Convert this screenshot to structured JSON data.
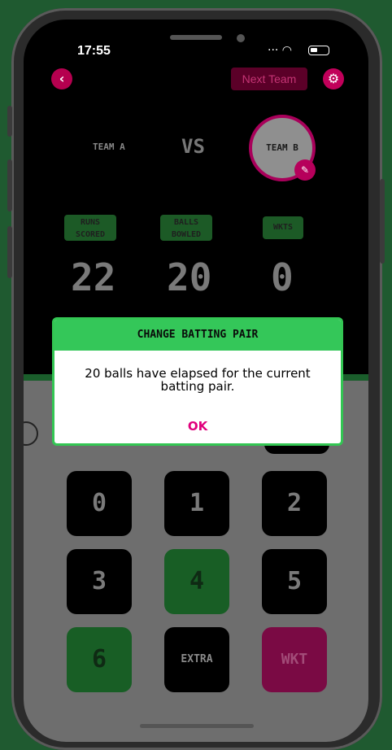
{
  "status_bar": {
    "time": "17:55"
  },
  "header": {
    "next_team_label": "Next Team"
  },
  "teams": {
    "team_a": "TEAM A",
    "vs": "VS",
    "team_b": "TEAM B"
  },
  "stats": {
    "runs_label": "RUNS\nSCORED",
    "runs_value": "22",
    "balls_label": "BALLS\nBOWLED",
    "balls_value": "20",
    "wkts_label": "WKTS",
    "wkts_value": "0"
  },
  "keypad": {
    "keys": [
      "0",
      "1",
      "2",
      "3",
      "4",
      "5",
      "6",
      "EXTRA",
      "WKT"
    ]
  },
  "dialog": {
    "title": "CHANGE BATTING PAIR",
    "message": "20 balls have elapsed for the current batting pair.",
    "ok_label": "OK"
  },
  "colors": {
    "accent_pink": "#e0007c",
    "accent_green": "#34c759",
    "background_green": "#1f5a30"
  }
}
